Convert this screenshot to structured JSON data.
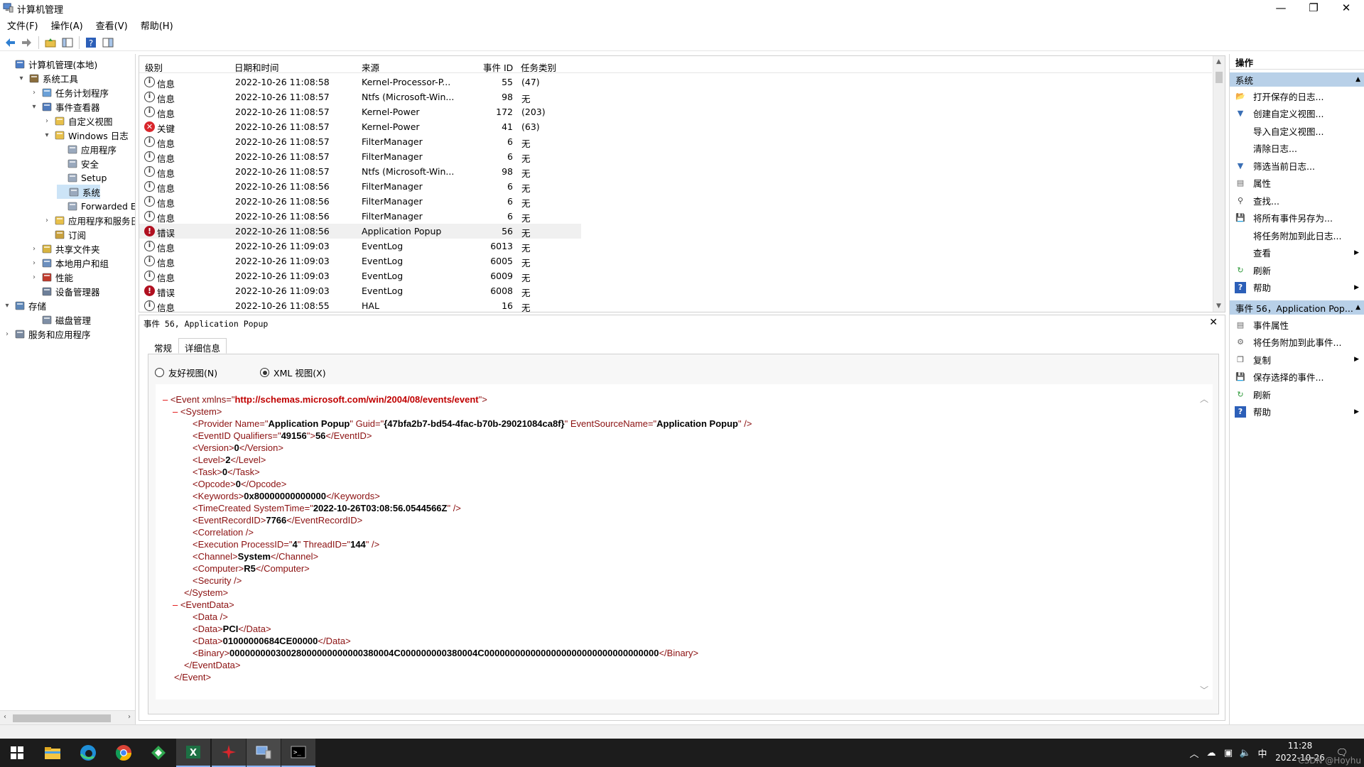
{
  "window": {
    "title": "计算机管理",
    "minimize_glyph": "—",
    "restore_glyph": "❐",
    "close_glyph": "✕"
  },
  "menu": [
    "文件(F)",
    "操作(A)",
    "查看(V)",
    "帮助(H)"
  ],
  "tree": {
    "items": [
      {
        "label": "计算机管理(本地)",
        "expander": "",
        "icon": "computer-icon"
      },
      {
        "label": "系统工具",
        "expander": "▾",
        "icon": "tools-icon"
      },
      {
        "label": "任务计划程序",
        "expander": "›",
        "icon": "clock-icon"
      },
      {
        "label": "事件查看器",
        "expander": "▾",
        "icon": "event-viewer-icon"
      },
      {
        "label": "自定义视图",
        "expander": "›",
        "icon": "folder-icon"
      },
      {
        "label": "Windows 日志",
        "expander": "▾",
        "icon": "folder-icon"
      },
      {
        "label": "应用程序",
        "expander": "",
        "icon": "log-icon"
      },
      {
        "label": "安全",
        "expander": "",
        "icon": "log-icon"
      },
      {
        "label": "Setup",
        "expander": "",
        "icon": "log-icon"
      },
      {
        "label": "系统",
        "expander": "",
        "icon": "log-icon"
      },
      {
        "label": "Forwarded Eve",
        "expander": "",
        "icon": "log-icon"
      },
      {
        "label": "应用程序和服务日志",
        "expander": "›",
        "icon": "folder-icon"
      },
      {
        "label": "订阅",
        "expander": "",
        "icon": "subscription-icon"
      },
      {
        "label": "共享文件夹",
        "expander": "›",
        "icon": "shared-folder-icon"
      },
      {
        "label": "本地用户和组",
        "expander": "›",
        "icon": "users-icon"
      },
      {
        "label": "性能",
        "expander": "›",
        "icon": "performance-icon"
      },
      {
        "label": "设备管理器",
        "expander": "",
        "icon": "device-manager-icon"
      },
      {
        "label": "存储",
        "expander": "▾",
        "icon": "storage-icon"
      },
      {
        "label": "磁盘管理",
        "expander": "",
        "icon": "disk-icon"
      },
      {
        "label": "服务和应用程序",
        "expander": "›",
        "icon": "services-icon"
      }
    ]
  },
  "events": {
    "columns": [
      "级别",
      "日期和时间",
      "来源",
      "事件 ID",
      "任务类别"
    ],
    "rows": [
      {
        "level": "信息",
        "type": "info",
        "datetime": "2022-10-26 11:08:58",
        "source": "Kernel-Processor-P...",
        "id": "55",
        "category": "(47)"
      },
      {
        "level": "信息",
        "type": "info",
        "datetime": "2022-10-26 11:08:57",
        "source": "Ntfs (Microsoft-Win...",
        "id": "98",
        "category": "无"
      },
      {
        "level": "信息",
        "type": "info",
        "datetime": "2022-10-26 11:08:57",
        "source": "Kernel-Power",
        "id": "172",
        "category": "(203)"
      },
      {
        "level": "关键",
        "type": "critical",
        "datetime": "2022-10-26 11:08:57",
        "source": "Kernel-Power",
        "id": "41",
        "category": "(63)"
      },
      {
        "level": "信息",
        "type": "info",
        "datetime": "2022-10-26 11:08:57",
        "source": "FilterManager",
        "id": "6",
        "category": "无"
      },
      {
        "level": "信息",
        "type": "info",
        "datetime": "2022-10-26 11:08:57",
        "source": "FilterManager",
        "id": "6",
        "category": "无"
      },
      {
        "level": "信息",
        "type": "info",
        "datetime": "2022-10-26 11:08:57",
        "source": "Ntfs (Microsoft-Win...",
        "id": "98",
        "category": "无"
      },
      {
        "level": "信息",
        "type": "info",
        "datetime": "2022-10-26 11:08:56",
        "source": "FilterManager",
        "id": "6",
        "category": "无"
      },
      {
        "level": "信息",
        "type": "info",
        "datetime": "2022-10-26 11:08:56",
        "source": "FilterManager",
        "id": "6",
        "category": "无"
      },
      {
        "level": "信息",
        "type": "info",
        "datetime": "2022-10-26 11:08:56",
        "source": "FilterManager",
        "id": "6",
        "category": "无"
      },
      {
        "level": "错误",
        "type": "error",
        "datetime": "2022-10-26 11:08:56",
        "source": "Application Popup",
        "id": "56",
        "category": "无"
      },
      {
        "level": "信息",
        "type": "info",
        "datetime": "2022-10-26 11:09:03",
        "source": "EventLog",
        "id": "6013",
        "category": "无"
      },
      {
        "level": "信息",
        "type": "info",
        "datetime": "2022-10-26 11:09:03",
        "source": "EventLog",
        "id": "6005",
        "category": "无"
      },
      {
        "level": "信息",
        "type": "info",
        "datetime": "2022-10-26 11:09:03",
        "source": "EventLog",
        "id": "6009",
        "category": "无"
      },
      {
        "level": "错误",
        "type": "error",
        "datetime": "2022-10-26 11:09:03",
        "source": "EventLog",
        "id": "6008",
        "category": "无"
      },
      {
        "level": "信息",
        "type": "info",
        "datetime": "2022-10-26 11:08:55",
        "source": "HAL",
        "id": "16",
        "category": "无"
      }
    ]
  },
  "details": {
    "title": "事件 56, Application Popup",
    "tabs": [
      "常规",
      "详细信息"
    ],
    "radio_friendly": "友好视图(N)",
    "radio_xml": "XML 视图(X)",
    "xml": {
      "namespace": "http://schemas.microsoft.com/win/2004/08/events/event",
      "provider_name": "Application Popup",
      "provider_guid": "{47bfa2b7-bd54-4fac-b70b-29021084ca8f}",
      "event_source_name": "Application Popup",
      "qualifiers": "49156",
      "event_id": "56",
      "version": "0",
      "level": "2",
      "task": "0",
      "opcode": "0",
      "keywords": "0x80000000000000",
      "system_time": "2022-10-26T03:08:56.0544566Z",
      "record_id": "7766",
      "process_id": "4",
      "thread_id": "144",
      "channel": "System",
      "computer": "R5",
      "data_pci": "PCI",
      "data_hex": "01000000684CE00000",
      "binary": "00000000030028000000000000380004C000000000380004C0000000000000000000000000000000000"
    }
  },
  "actions": {
    "header": "操作",
    "section1": "系统",
    "items1": [
      {
        "label": "打开保存的日志...",
        "icon": "open-log-icon",
        "sub": false
      },
      {
        "label": "创建自定义视图...",
        "icon": "filter-icon",
        "sub": false
      },
      {
        "label": "导入自定义视图...",
        "icon": "",
        "sub": false
      },
      {
        "label": "清除日志...",
        "icon": "",
        "sub": false
      },
      {
        "label": "筛选当前日志...",
        "icon": "filter-icon",
        "sub": false
      },
      {
        "label": "属性",
        "icon": "properties-icon",
        "sub": false
      },
      {
        "label": "查找...",
        "icon": "find-icon",
        "sub": false
      },
      {
        "label": "将所有事件另存为...",
        "icon": "save-icon",
        "sub": false
      },
      {
        "label": "将任务附加到此日志...",
        "icon": "",
        "sub": false
      },
      {
        "label": "查看",
        "icon": "",
        "sub": true
      },
      {
        "label": "刷新",
        "icon": "refresh-icon",
        "sub": false
      },
      {
        "label": "帮助",
        "icon": "help-icon",
        "sub": true
      }
    ],
    "section2": "事件 56，Application Pop...",
    "items2": [
      {
        "label": "事件属性",
        "icon": "properties-icon",
        "sub": false
      },
      {
        "label": "将任务附加到此事件...",
        "icon": "task-icon",
        "sub": false
      },
      {
        "label": "复制",
        "icon": "copy-icon",
        "sub": true
      },
      {
        "label": "保存选择的事件...",
        "icon": "save-icon",
        "sub": false
      },
      {
        "label": "刷新",
        "icon": "refresh-icon",
        "sub": false
      },
      {
        "label": "帮助",
        "icon": "help-icon",
        "sub": true
      }
    ]
  },
  "taskbar": {
    "time": "11:28",
    "date": "2022-10-26",
    "ime": "中",
    "watermark": "CSDN @Hoyhu"
  }
}
